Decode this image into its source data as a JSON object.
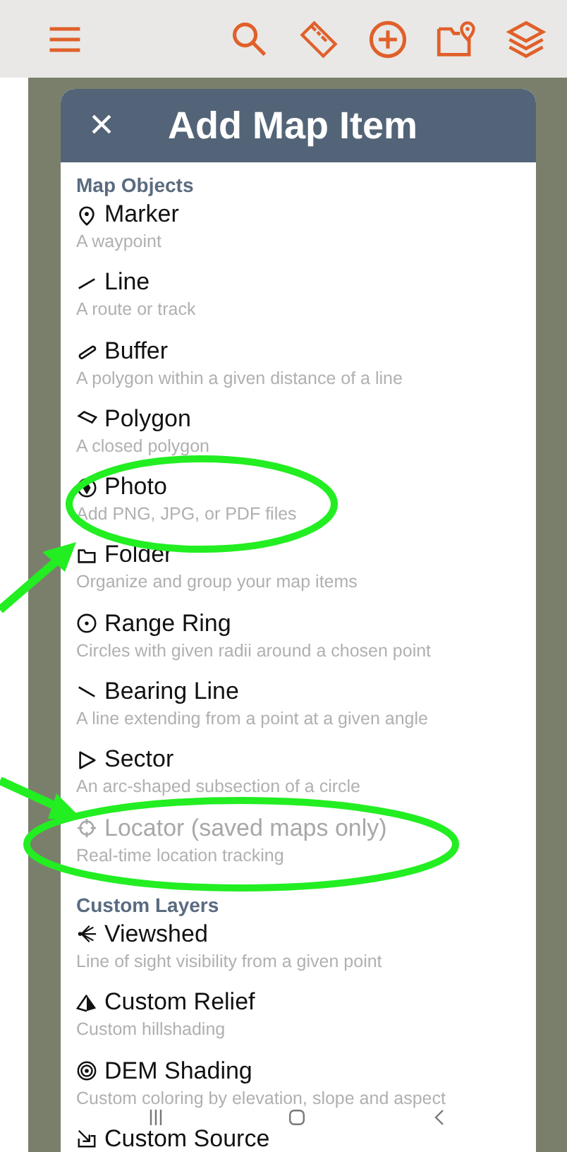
{
  "dialog": {
    "title": "Add Map Item",
    "close_label": "×"
  },
  "sections": [
    {
      "heading": "Map Objects",
      "items": [
        {
          "title": "Marker",
          "description": "A waypoint",
          "disabled": false
        },
        {
          "title": "Line",
          "description": "A route or track",
          "disabled": false
        },
        {
          "title": "Buffer",
          "description": "A polygon within a given distance of a line",
          "disabled": false
        },
        {
          "title": "Polygon",
          "description": "A closed polygon",
          "disabled": false
        },
        {
          "title": "Photo",
          "description": "Add PNG, JPG, or PDF files",
          "disabled": false
        },
        {
          "title": "Folder",
          "description": "Organize and group your map items",
          "disabled": false
        },
        {
          "title": "Range Ring",
          "description": "Circles with given radii around a chosen point",
          "disabled": false
        },
        {
          "title": "Bearing Line",
          "description": "A line extending from a point at a given angle",
          "disabled": false
        },
        {
          "title": "Sector",
          "description": "An arc-shaped subsection of a circle",
          "disabled": false
        },
        {
          "title": "Locator (saved maps only)",
          "description": "Real-time location tracking",
          "disabled": true
        }
      ]
    },
    {
      "heading": "Custom Layers",
      "items": [
        {
          "title": "Viewshed",
          "description": "Line of sight visibility from a given point",
          "disabled": false
        },
        {
          "title": "Custom Relief",
          "description": "Custom hillshading",
          "disabled": false
        },
        {
          "title": "DEM Shading",
          "description": "Custom coloring by elevation, slope and aspect",
          "disabled": false
        },
        {
          "title": "Custom Source",
          "disabled": false
        }
      ]
    }
  ]
}
